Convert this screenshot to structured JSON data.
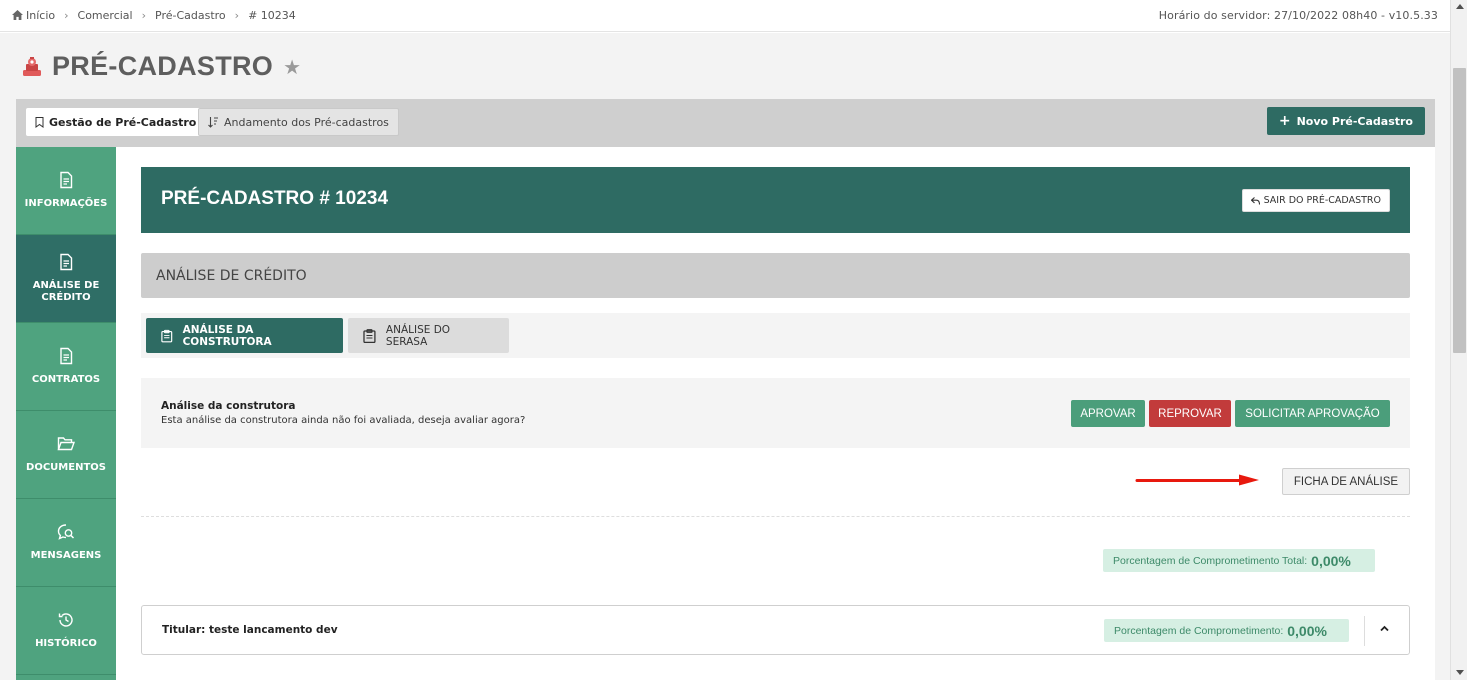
{
  "breadcrumb": {
    "items": [
      "Início",
      "Comercial",
      "Pré-Cadastro",
      "# 10234"
    ]
  },
  "server_time": "Horário do servidor: 27/10/2022 08h40 - v10.5.33",
  "page": {
    "title": "PRÉ-CADASTRO"
  },
  "tabs": {
    "gestao": "Gestão de Pré-Cadastro",
    "andamento": "Andamento dos Pré-cadastros",
    "novo": "Novo Pré-Cadastro"
  },
  "sidebar": {
    "items": [
      {
        "label": "INFORMAÇÕES",
        "icon": "document-icon"
      },
      {
        "label_line1": "ANÁLISE DE",
        "label_line2": "CRÉDITO",
        "icon": "document-icon"
      },
      {
        "label": "CONTRATOS",
        "icon": "document-icon"
      },
      {
        "label": "DOCUMENTOS",
        "icon": "folder-open-icon"
      },
      {
        "label": "MENSAGENS",
        "icon": "chat-search-icon"
      },
      {
        "label": "HISTÓRICO",
        "icon": "history-icon"
      }
    ]
  },
  "header": {
    "title": "PRÉ-CADASTRO # 10234",
    "exit_label": "SAIR DO PRÉ-CADASTRO"
  },
  "section": {
    "title": "ANÁLISE DE CRÉDITO"
  },
  "subtabs": {
    "construtora": "ANÁLISE DA CONSTRUTORA",
    "serasa": "ANÁLISE DO SERASA"
  },
  "analysis": {
    "title": "Análise da construtora",
    "description": "Esta análise da construtora ainda não foi avaliada, deseja avaliar agora?",
    "approve": "APROVAR",
    "reject": "REPROVAR",
    "request": "SOLICITAR APROVAÇÃO",
    "ficha": "FICHA DE ANÁLISE"
  },
  "commitment": {
    "total_label": "Porcentagem de Comprometimento Total:",
    "total_value": "0,00%",
    "holder_label": "Porcentagem de Comprometimento:",
    "holder_value": "0,00%"
  },
  "titular": {
    "label": "Titular: teste lancamento dev"
  },
  "colors": {
    "primary_dark": "#2e6b63",
    "sidebar_green": "#4fa37f",
    "approve": "#4b9e7b",
    "reject": "#c23b3b",
    "badge_bg": "#d6efe3",
    "arrow": "#e8190e"
  }
}
